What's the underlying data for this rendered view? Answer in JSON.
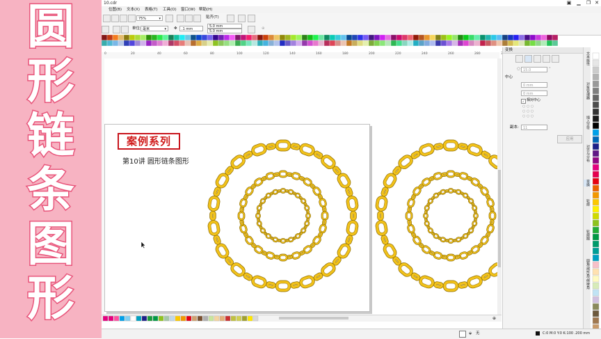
{
  "banner": {
    "text": "圆形链条图形",
    "chars": [
      "圆",
      "形",
      "链",
      "条",
      "图",
      "形"
    ],
    "bg": "#f7b3c2",
    "fg": "#ffffff",
    "outline": "#e8547a"
  },
  "titlebar": {
    "title": "10.cdr",
    "min": "▁",
    "restore": "❐",
    "close": "✕"
  },
  "menus": [
    "位图(B)",
    "文本(X)",
    "表格(T)",
    "工具(O)",
    "窗口(W)",
    "帮助(H)"
  ],
  "toolbar": {
    "zoom": "75%",
    "snap": "贴齐(T)"
  },
  "propbar": {
    "units_label": "单位:",
    "units_value": "毫米",
    "nudge": ".1 mm",
    "dup_x": "5.0 mm",
    "dup_y": "5.0 mm"
  },
  "ruler": {
    "ticks": [
      "0",
      "20",
      "40",
      "60",
      "80",
      "100",
      "120",
      "140",
      "160",
      "180",
      "200",
      "220",
      "240",
      "260",
      "280",
      "300"
    ]
  },
  "page": {
    "series_label": "案例系列",
    "subtitle": "第10讲 圆形链条图形"
  },
  "chain": {
    "fill": "#f2c21a",
    "stroke": "#8a6a00",
    "inner": "#ffffff"
  },
  "docker": {
    "title": "变换",
    "angle": "15.0",
    "angle_unit": "°",
    "center_label": "中心",
    "cx": "0 mm",
    "cy": "0 mm",
    "relative_center": "相对中心",
    "copies_label": "副本:",
    "copies": "11",
    "apply": "应用"
  },
  "right_tabs": [
    "文本属性",
    "对象管理器",
    "插入字符",
    "对齐与分布",
    "变换",
    "轮廓",
    "轮廓图",
    "圆角/扇形角/倒棱角"
  ],
  "status": {
    "fill_none": "无",
    "color_info": "C:0 M:0 Y:0 K:100  .200 mm"
  },
  "colors": {
    "accent": "#c8141c",
    "ui_bg": "#f3f3f3"
  }
}
